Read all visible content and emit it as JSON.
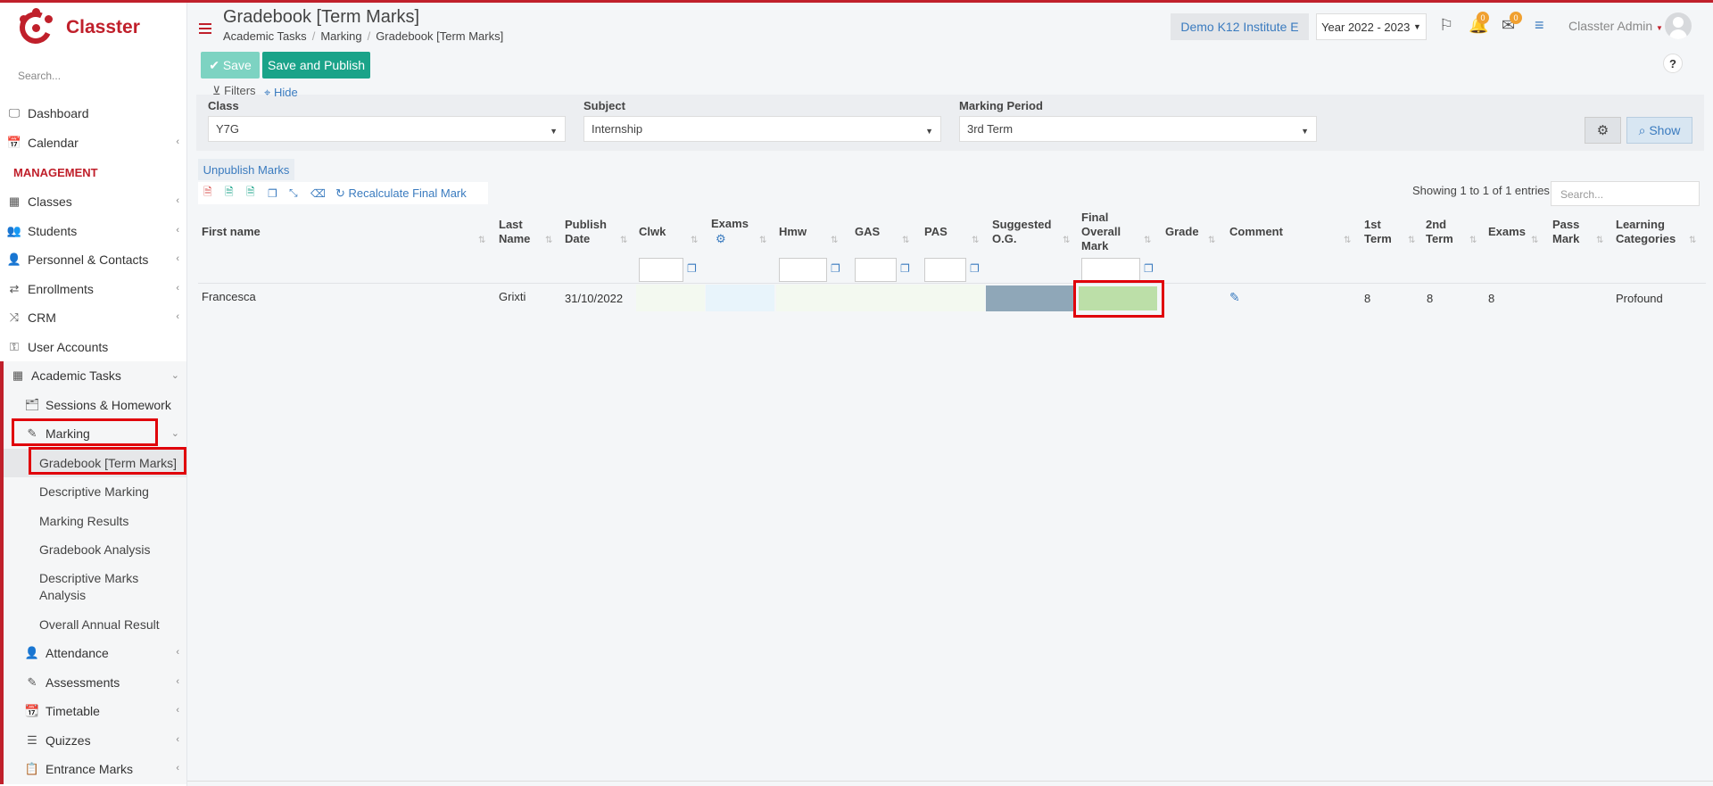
{
  "app": {
    "brand": "Classter",
    "search_placeholder": "Search..."
  },
  "sidebar": {
    "section_label": "MANAGEMENT",
    "items_top": [
      {
        "label": "Dashboard",
        "icon": "laptop-icon"
      },
      {
        "label": "Calendar",
        "icon": "calendar-icon"
      }
    ],
    "items_mgmt": [
      {
        "label": "Classes",
        "icon": "classes-icon"
      },
      {
        "label": "Students",
        "icon": "students-icon"
      },
      {
        "label": "Personnel & Contacts",
        "icon": "person-icon"
      },
      {
        "label": "Enrollments",
        "icon": "exchange-icon"
      },
      {
        "label": "CRM",
        "icon": "shuffle-icon"
      },
      {
        "label": "User Accounts",
        "icon": "key-icon"
      }
    ],
    "academic_tasks": "Academic Tasks",
    "sessions": "Sessions & Homework",
    "marking": "Marking",
    "marking_items": [
      "Gradebook [Term Marks]",
      "Descriptive Marking",
      "Marking Results",
      "Gradebook Analysis",
      "Descriptive Marks Analysis",
      "Overall Annual Result"
    ],
    "after_items": [
      {
        "label": "Attendance",
        "icon": "attendance-icon"
      },
      {
        "label": "Assessments",
        "icon": "assessments-icon"
      },
      {
        "label": "Timetable",
        "icon": "timetable-icon"
      },
      {
        "label": "Quizzes",
        "icon": "quizzes-icon"
      },
      {
        "label": "Entrance Marks",
        "icon": "clipboard-icon"
      }
    ]
  },
  "header": {
    "title": "Gradebook [Term Marks]",
    "breadcrumb": [
      "Academic Tasks",
      "Marking",
      "Gradebook [Term Marks]"
    ],
    "institute": "Demo K12 Institute E",
    "year": "Year 2022 - 2023",
    "notif_count": "0",
    "mail_count": "0",
    "user": "Classter Admin"
  },
  "actions": {
    "save": "Save",
    "save_publish": "Save and Publish",
    "help": "?"
  },
  "filters": {
    "label": "Filters",
    "hide": "Hide",
    "class_label": "Class",
    "class_value": "Y7G",
    "subject_label": "Subject",
    "subject_value": "Internship",
    "period_label": "Marking Period",
    "period_value": "3rd Term",
    "show": "Show"
  },
  "table": {
    "unpublish": "Unpublish Marks",
    "recalculate": "Recalculate Final Mark",
    "entries": "Showing 1 to 1 of 1 entries",
    "search_placeholder": "Search...",
    "headers": {
      "first_name": "First name",
      "last_name_1": "Last",
      "last_name_2": "Name",
      "publish_1": "Publish",
      "publish_2": "Date",
      "clwk": "Clwk",
      "exams": "Exams",
      "hmw": "Hmw",
      "gas": "GAS",
      "pas": "PAS",
      "sog_1": "Suggested",
      "sog_2": "O.G.",
      "fom_1": "Final",
      "fom_2": "Overall",
      "fom_3": "Mark",
      "grade": "Grade",
      "comment": "Comment",
      "t1_1": "1st",
      "t1_2": "Term",
      "t2_1": "2nd",
      "t2_2": "Term",
      "exams2": "Exams",
      "pass_1": "Pass",
      "pass_2": "Mark",
      "lc_1": "Learning",
      "lc_2": "Categories"
    },
    "row": {
      "first_name": "Francesca",
      "last_name": "Grixti",
      "publish_date": "31/10/2022",
      "term1": "8",
      "term2": "8",
      "exams": "8",
      "category": "Profound"
    }
  },
  "colors": {
    "brand": "#c0202b",
    "primary": "#1aa389",
    "link": "#3a7bbf",
    "highlight": "#e0000a"
  }
}
